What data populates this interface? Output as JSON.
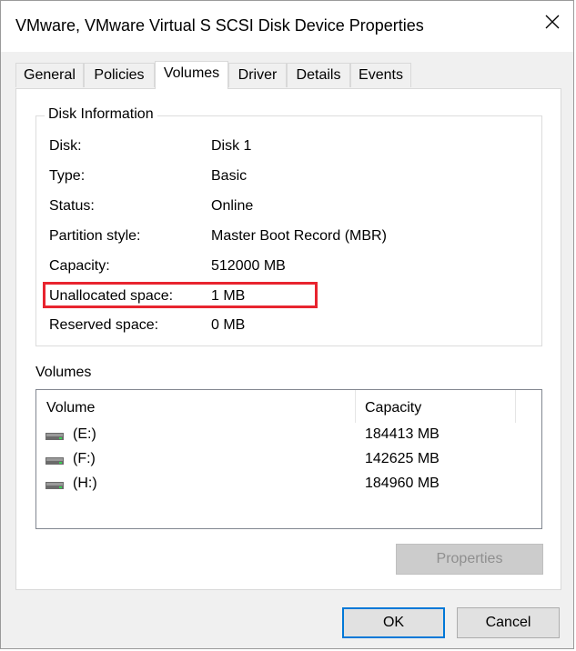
{
  "window": {
    "title": "VMware, VMware Virtual S SCSI Disk Device Properties"
  },
  "tabs": [
    {
      "label": "General"
    },
    {
      "label": "Policies"
    },
    {
      "label": "Volumes",
      "active": true
    },
    {
      "label": "Driver"
    },
    {
      "label": "Details"
    },
    {
      "label": "Events"
    }
  ],
  "disk_info": {
    "legend": "Disk Information",
    "rows": [
      {
        "label": "Disk:",
        "value": "Disk 1"
      },
      {
        "label": "Type:",
        "value": "Basic"
      },
      {
        "label": "Status:",
        "value": "Online"
      },
      {
        "label": "Partition style:",
        "value": "Master Boot Record (MBR)"
      },
      {
        "label": "Capacity:",
        "value": "512000 MB"
      },
      {
        "label": "Unallocated space:",
        "value": "1 MB",
        "highlighted": true
      },
      {
        "label": "Reserved space:",
        "value": "0 MB"
      }
    ]
  },
  "volumes": {
    "label": "Volumes",
    "columns": [
      "Volume",
      "Capacity"
    ],
    "rows": [
      {
        "name": "(E:)",
        "capacity": "184413 MB"
      },
      {
        "name": "(F:)",
        "capacity": "142625 MB"
      },
      {
        "name": "(H:)",
        "capacity": "184960 MB"
      }
    ]
  },
  "buttons": {
    "properties": "Properties",
    "ok": "OK",
    "cancel": "Cancel"
  },
  "colors": {
    "highlight": "#e8242f",
    "default_button_border": "#0078d7"
  },
  "icons": {
    "close": "close-icon",
    "drive": "drive-icon"
  }
}
